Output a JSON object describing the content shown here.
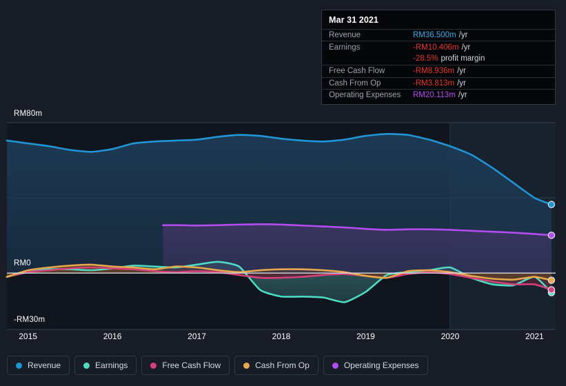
{
  "chart_data": {
    "type": "area",
    "title": "",
    "xlabel": "",
    "ylabel": "",
    "currency": "RM",
    "units": "m",
    "grid": true,
    "legend_position": "bottom-left",
    "ylim": [
      -30,
      80
    ],
    "y_ticks": [
      {
        "value": 80,
        "label": "RM80m"
      },
      {
        "value": 0,
        "label": "RM0"
      },
      {
        "value": -30,
        "label": "-RM30m"
      }
    ],
    "x_ticks": [
      "2015",
      "2016",
      "2017",
      "2018",
      "2019",
      "2020",
      "2021"
    ],
    "x_range": [
      "2014.75",
      "2021.25"
    ],
    "forecast_divider_x": "2020.0",
    "series": [
      {
        "name": "Revenue",
        "color": "#2196d6",
        "fill": "#1d3b56",
        "x": [
          2014.75,
          2015.0,
          2015.25,
          2015.5,
          2015.75,
          2016.0,
          2016.25,
          2016.5,
          2016.75,
          2017.0,
          2017.25,
          2017.5,
          2017.75,
          2018.0,
          2018.25,
          2018.5,
          2018.75,
          2019.0,
          2019.25,
          2019.5,
          2019.75,
          2020.0,
          2020.25,
          2020.5,
          2020.75,
          2021.0,
          2021.2
        ],
        "values": [
          70.5,
          69.0,
          67.5,
          65.5,
          64.5,
          66.0,
          69.0,
          70.0,
          70.5,
          71.0,
          72.5,
          73.5,
          73.0,
          71.5,
          70.5,
          70.0,
          71.0,
          73.0,
          74.0,
          73.5,
          71.0,
          67.5,
          63.0,
          56.0,
          48.0,
          40.0,
          36.5
        ]
      },
      {
        "name": "Earnings",
        "color": "#4ddbc4",
        "fill": "#2e5b5e",
        "x": [
          2014.75,
          2015.0,
          2015.25,
          2015.5,
          2015.75,
          2016.0,
          2016.25,
          2016.5,
          2016.75,
          2017.0,
          2017.25,
          2017.5,
          2017.75,
          2018.0,
          2018.25,
          2018.5,
          2018.75,
          2019.0,
          2019.25,
          2019.5,
          2019.75,
          2020.0,
          2020.25,
          2020.5,
          2020.75,
          2021.0,
          2021.2
        ],
        "values": [
          -2.0,
          0.5,
          2.0,
          2.0,
          1.5,
          2.5,
          4.0,
          3.5,
          3.0,
          4.5,
          6.0,
          3.5,
          -9.0,
          -12.5,
          -12.5,
          -13.0,
          -15.5,
          -10.0,
          -1.0,
          0.5,
          1.5,
          3.0,
          -2.5,
          -6.0,
          -6.5,
          -2.0,
          -10.4
        ]
      },
      {
        "name": "Free Cash Flow",
        "color": "#d6417a",
        "fill": "#5a2230",
        "x": [
          2014.75,
          2015.0,
          2015.25,
          2015.5,
          2015.75,
          2016.0,
          2016.25,
          2016.5,
          2016.75,
          2017.0,
          2017.25,
          2017.5,
          2017.75,
          2018.0,
          2018.25,
          2018.5,
          2018.75,
          2019.0,
          2019.25,
          2019.5,
          2019.75,
          2020.0,
          2020.25,
          2020.5,
          2020.75,
          2021.0,
          2021.2
        ],
        "values": [
          -2.0,
          0.5,
          1.5,
          2.5,
          3.0,
          2.5,
          2.0,
          1.0,
          0.5,
          1.0,
          0.5,
          -1.0,
          -2.5,
          -2.5,
          -2.0,
          -1.0,
          -0.5,
          -1.5,
          -2.5,
          -0.5,
          0.5,
          -0.5,
          -2.5,
          -4.5,
          -6.0,
          -6.0,
          -8.9
        ]
      },
      {
        "name": "Cash From Op",
        "color": "#e8a84c",
        "fill": "#5a4424",
        "x": [
          2014.75,
          2015.0,
          2015.25,
          2015.5,
          2015.75,
          2016.0,
          2016.25,
          2016.5,
          2016.75,
          2017.0,
          2017.25,
          2017.5,
          2017.75,
          2018.0,
          2018.25,
          2018.5,
          2018.75,
          2019.0,
          2019.25,
          2019.5,
          2019.75,
          2020.0,
          2020.25,
          2020.5,
          2020.75,
          2021.0,
          2021.2
        ],
        "values": [
          -2.0,
          1.5,
          3.0,
          4.0,
          4.5,
          3.5,
          3.0,
          2.0,
          3.5,
          3.0,
          1.5,
          0.5,
          1.5,
          2.0,
          2.0,
          1.5,
          0.5,
          -1.5,
          -2.5,
          1.0,
          1.5,
          0.5,
          -1.5,
          -3.0,
          -3.5,
          -2.0,
          -3.8
        ]
      },
      {
        "name": "Operating Expenses",
        "color": "#b44df0",
        "fill": "#3b3460",
        "x": [
          2016.6,
          2016.8,
          2017.0,
          2017.25,
          2017.5,
          2017.75,
          2018.0,
          2018.25,
          2018.5,
          2018.75,
          2019.0,
          2019.25,
          2019.5,
          2019.75,
          2020.0,
          2020.25,
          2020.5,
          2020.75,
          2021.0,
          2021.2
        ],
        "values": [
          25.5,
          25.5,
          25.3,
          25.5,
          25.8,
          26.0,
          25.8,
          25.3,
          24.8,
          24.3,
          23.5,
          23.0,
          23.3,
          23.3,
          23.0,
          22.5,
          22.0,
          21.5,
          20.8,
          20.1
        ]
      }
    ]
  },
  "tooltip": {
    "date": "Mar 31 2021",
    "rows": [
      {
        "label": "Revenue",
        "value": "RM36.500m",
        "color": "#3dabe8",
        "unit": "/yr"
      },
      {
        "label": "Earnings",
        "value": "-RM10.406m",
        "color": "#e8342c",
        "unit": "/yr"
      },
      {
        "label": "",
        "value": "-28.5%",
        "color": "#e8342c",
        "sub": "profit margin"
      },
      {
        "label": "Free Cash Flow",
        "value": "-RM8.936m",
        "color": "#e8342c",
        "unit": "/yr"
      },
      {
        "label": "Cash From Op",
        "value": "-RM3.813m",
        "color": "#e8342c",
        "unit": "/yr"
      },
      {
        "label": "Operating Expenses",
        "value": "RM20.113m",
        "color": "#b44df0",
        "unit": "/yr"
      }
    ]
  },
  "legend": {
    "items": [
      {
        "label": "Revenue",
        "color": "#2196d6"
      },
      {
        "label": "Earnings",
        "color": "#4ddbc4"
      },
      {
        "label": "Free Cash Flow",
        "color": "#d6417a"
      },
      {
        "label": "Cash From Op",
        "color": "#e8a84c"
      },
      {
        "label": "Operating Expenses",
        "color": "#b44df0"
      }
    ]
  },
  "axes": {
    "y_top": "RM80m",
    "y_zero": "RM0",
    "y_bottom": "-RM30m"
  }
}
